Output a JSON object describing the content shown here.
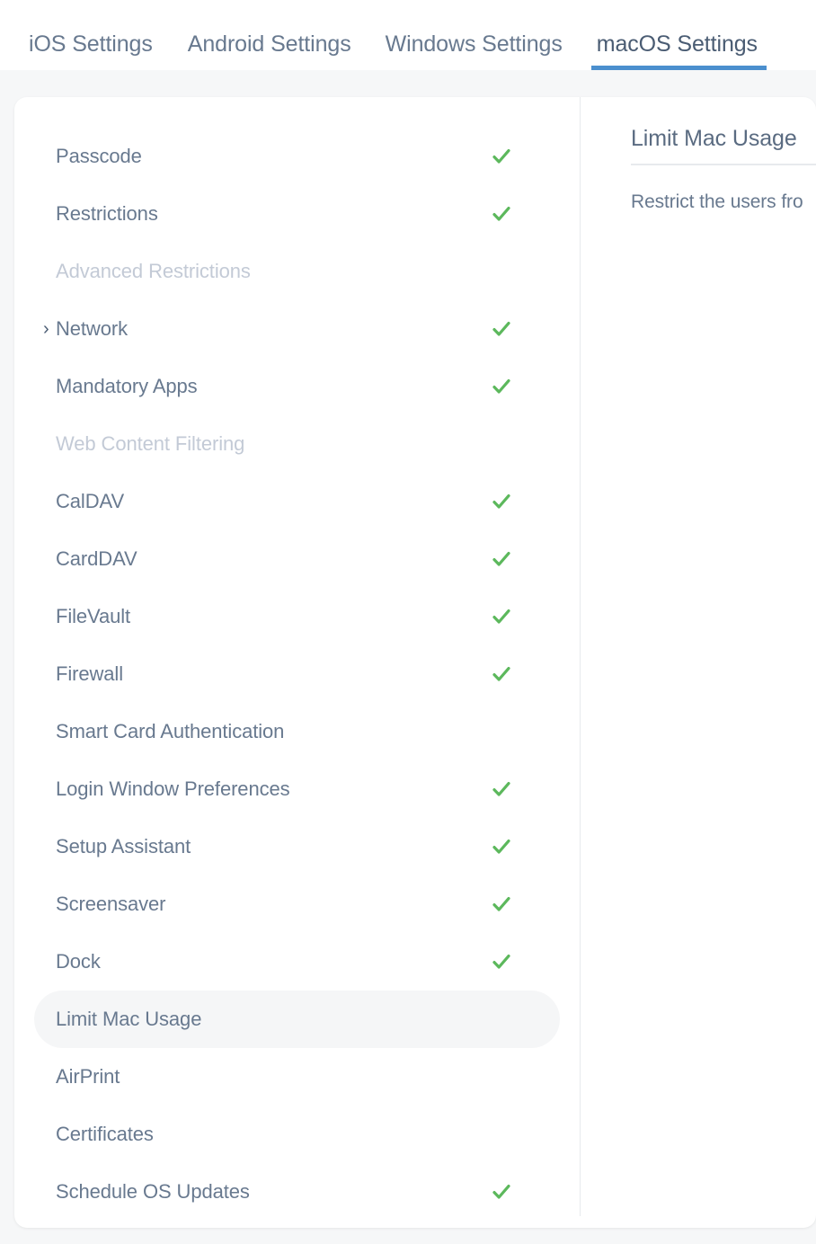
{
  "tabs": [
    {
      "label": "iOS Settings",
      "active": false
    },
    {
      "label": "Android Settings",
      "active": false
    },
    {
      "label": "Windows Settings",
      "active": false
    },
    {
      "label": "macOS Settings",
      "active": true
    }
  ],
  "accent_color": "#4b8fce",
  "check_color": "#5cb85c",
  "settings_list": [
    {
      "label": "Passcode",
      "checked": true,
      "disabled": false,
      "expandable": false,
      "selected": false
    },
    {
      "label": "Restrictions",
      "checked": true,
      "disabled": false,
      "expandable": false,
      "selected": false
    },
    {
      "label": "Advanced Restrictions",
      "checked": false,
      "disabled": true,
      "expandable": false,
      "selected": false
    },
    {
      "label": "Network",
      "checked": true,
      "disabled": false,
      "expandable": true,
      "selected": false
    },
    {
      "label": "Mandatory Apps",
      "checked": true,
      "disabled": false,
      "expandable": false,
      "selected": false
    },
    {
      "label": "Web Content Filtering",
      "checked": false,
      "disabled": true,
      "expandable": false,
      "selected": false
    },
    {
      "label": "CalDAV",
      "checked": true,
      "disabled": false,
      "expandable": false,
      "selected": false
    },
    {
      "label": "CardDAV",
      "checked": true,
      "disabled": false,
      "expandable": false,
      "selected": false
    },
    {
      "label": "FileVault",
      "checked": true,
      "disabled": false,
      "expandable": false,
      "selected": false
    },
    {
      "label": "Firewall",
      "checked": true,
      "disabled": false,
      "expandable": false,
      "selected": false
    },
    {
      "label": "Smart Card Authentication",
      "checked": false,
      "disabled": false,
      "expandable": false,
      "selected": false
    },
    {
      "label": "Login Window Preferences",
      "checked": true,
      "disabled": false,
      "expandable": false,
      "selected": false
    },
    {
      "label": "Setup Assistant",
      "checked": true,
      "disabled": false,
      "expandable": false,
      "selected": false
    },
    {
      "label": "Screensaver",
      "checked": true,
      "disabled": false,
      "expandable": false,
      "selected": false
    },
    {
      "label": "Dock",
      "checked": true,
      "disabled": false,
      "expandable": false,
      "selected": false
    },
    {
      "label": "Limit Mac Usage",
      "checked": false,
      "disabled": false,
      "expandable": false,
      "selected": true
    },
    {
      "label": "AirPrint",
      "checked": false,
      "disabled": false,
      "expandable": false,
      "selected": false
    },
    {
      "label": "Certificates",
      "checked": false,
      "disabled": false,
      "expandable": false,
      "selected": false
    },
    {
      "label": "Schedule OS Updates",
      "checked": true,
      "disabled": false,
      "expandable": false,
      "selected": false
    }
  ],
  "detail": {
    "title": "Limit Mac Usage",
    "description": "Restrict the users fro"
  },
  "icons": {
    "chevron_right": "›",
    "check": "check-icon"
  }
}
